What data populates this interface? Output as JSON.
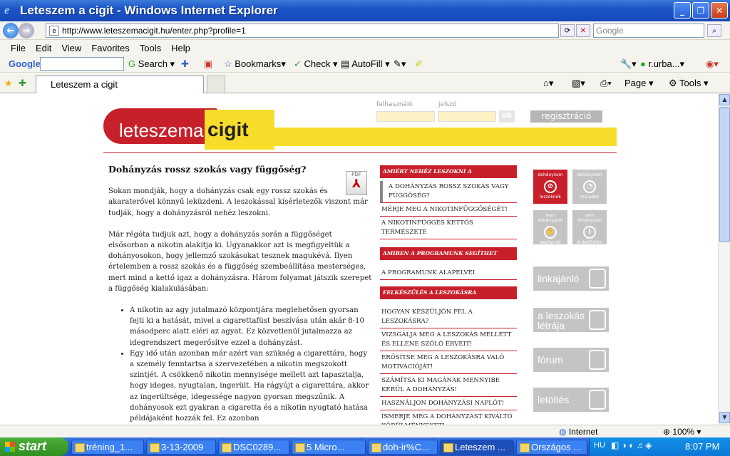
{
  "window": {
    "title": "Leteszem a cigit - Windows Internet Explorer"
  },
  "address": {
    "url": "http://www.leteszemacigit.hu/enter.php?profile=1",
    "search_placeholder": "Google"
  },
  "menu": [
    "File",
    "Edit",
    "View",
    "Favorites",
    "Tools",
    "Help"
  ],
  "google_toolbar": {
    "brand": "Google",
    "search": "Search",
    "bookmarks": "Bookmarks",
    "check": "Check",
    "autofill": "AutoFill",
    "user": "r.urba..."
  },
  "tab": {
    "label": "Leteszem a cigit",
    "page": "Page",
    "tools": "Tools"
  },
  "site": {
    "logo_left": "leteszema",
    "logo_right": "cigit",
    "login_user_label": "felhasználó",
    "login_pass_label": "jelszó",
    "ok": "ok",
    "register": "regisztráció"
  },
  "article": {
    "title": "Dohányzás rossz szokás vagy függőség?",
    "pdf_label": "PDF",
    "p1": "Sokan mondják, hogy a dohányzás csak egy rossz szokás és akaraterővel könnyű leküzdeni. A leszokással kísérletezők viszont már tudják, hogy a dohányzásról nehéz leszokni.",
    "p2": "Már régóta tudjuk azt, hogy a dohányzás során a függőséget elsősorban a nikotin alakítja ki. Ugyanakkor azt is megfigyeltük a dohányosokon, hogy jellemző szokásokat tesznek magukévá. Ilyen értelemben a rossz szokás és a függőség szembeállítása mesterséges, mert mind a kettő igaz a dohányzásra. Három folyamat játszik szerepet a függőség kialakulásában:",
    "li1": "A nikotin az agy jutalmazó központjára meglehetősen gyorsan fejti ki a hatását, mivel a cigarettafüst beszívása után akár 8-10 másodperc alatt eléri az agyat. Ez közvetlenül jutalmazza az idegrendszert megerősítve ezzel a dohányzást.",
    "li2": "Egy idő után azonban már azért van szükség a cigarettára, hogy a személy fenntartsa a szervezetében a nikotin megszokott szintjét. A csökkenő nikotin mennyisége mellett azt tapasztalja, hogy ideges, nyugtalan, ingerült. Ha rágyújt a cigarettára, akkor az ingerültsége, idegessége nagyon gyorsan megszűnik. A dohányosok ezt gyakran a cigaretta és a nikotin nyugtató hatása példájaként hozzák fel. Ez azonban"
  },
  "sidebar": {
    "s1": "AMIÉRT NEHÉZ LESZOKNI A DOHÁNYZÁSRÓL",
    "s1_items": [
      "A DOHÁNYZÁS ROSSZ SZOKÁS VAGY FÜGGŐSÉG?",
      "MÉRJE MEG A NIKOTINFÜGGŐSÉGÉT!",
      "A NIKOTINFÜGGÉS KETTŐS TERMÉSZETE"
    ],
    "s2": "AMIBEN A PROGRAMUNK SEGÍTHET",
    "s2_items": [
      "A PROGRAMUNK ALAPELVEI"
    ],
    "s3": "FELKÉSZÜLÉS A LESZOKÁSRA",
    "s3_items": [
      "HOGYAN KÉSZÜLJÖN FEL A LESZOKÁSRA?",
      "VIZSGÁLJA MEG A LESZOKÁS MELLETT ÉS ELLENE SZÓLÓ ÉRVEIT!",
      "ERŐSÍTSE MEG A LESZOKÁSRA VALÓ MOTIVÁCIÓJÁT!",
      "SZÁMÍTSA KI MAGÁNAK MENNYIBE KERÜL A DOHÁNYZÁS!",
      "HASZNÁLJON DOHÁNYZÁSI NAPLÓT!",
      "ISMERJE MEG A DOHÁNYZÁST KIVÁLTÓ KÖRÜLMÉNYEKET!"
    ]
  },
  "profiles": {
    "p1_top": "dohányzom",
    "p1_bot": "leszoknék",
    "p2_top": "dohányzom",
    "p2_bot": "maradok",
    "p3_top": "nem dohányzom",
    "p3_bot": "segítenék",
    "p4_top": "nem dohányzom",
    "p4_bot": "érdeklődöm"
  },
  "banners": {
    "b1": "linkajánló",
    "b2": "a leszokás létrája",
    "b3": "fórum",
    "b4": "letöltés"
  },
  "status": {
    "zone": "Internet",
    "zoom": "100%"
  },
  "taskbar": {
    "start": "start",
    "items": [
      "tréning_1...",
      "3-13-2009",
      "DSC0289...",
      "5 Micro...",
      "doh-ir%C...",
      "Leteszem ...",
      "Országos ..."
    ],
    "lang": "HU",
    "clock": "8:07 PM"
  }
}
